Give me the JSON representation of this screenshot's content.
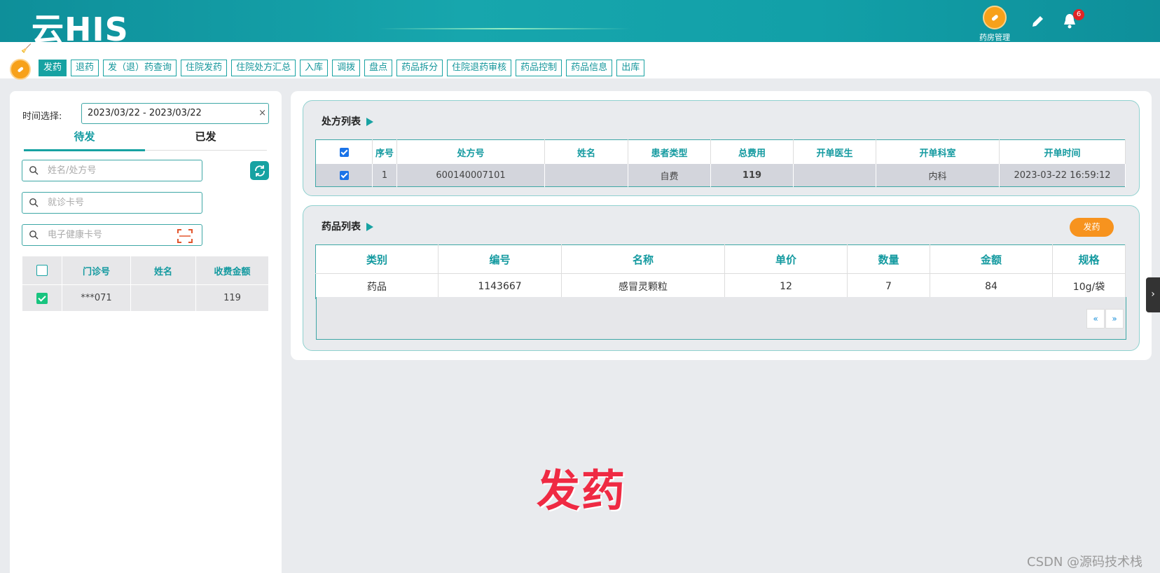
{
  "app": {
    "logo": "云HIS",
    "module_label": "药房管理",
    "notification_count": "6"
  },
  "tabs": [
    {
      "label": "发药",
      "active": true
    },
    {
      "label": "退药",
      "active": false
    },
    {
      "label": "发（退）药查询",
      "active": false
    },
    {
      "label": "住院发药",
      "active": false
    },
    {
      "label": "住院处方汇总",
      "active": false
    },
    {
      "label": "入库",
      "active": false
    },
    {
      "label": "调拨",
      "active": false
    },
    {
      "label": "盘点",
      "active": false
    },
    {
      "label": "药品拆分",
      "active": false
    },
    {
      "label": "住院退药审核",
      "active": false
    },
    {
      "label": "药品控制",
      "active": false
    },
    {
      "label": "药品信息",
      "active": false
    },
    {
      "label": "出库",
      "active": false
    }
  ],
  "left": {
    "time_label": "时间选择:",
    "date_range": "2023/03/22 - 2023/03/22",
    "clear_symbol": "×",
    "status_tabs": {
      "pending": "待发",
      "done": "已发"
    },
    "search_name_placeholder": "姓名/处方号",
    "search_card_placeholder": "就诊卡号",
    "search_health_placeholder": "电子健康卡号",
    "patient_table": {
      "headers": [
        "门诊号",
        "姓名",
        "收费金额"
      ],
      "rows": [
        {
          "checked": true,
          "clinic_no": "***071",
          "name": "",
          "amount": "119"
        }
      ]
    }
  },
  "prescriptions": {
    "title": "处方列表",
    "headers": [
      "序号",
      "处方号",
      "姓名",
      "患者类型",
      "总费用",
      "开单医生",
      "开单科室",
      "开单时间"
    ],
    "rows": [
      {
        "checked": true,
        "seq": "1",
        "rx_no": "600140007101",
        "name": "",
        "patient_type": "自费",
        "total": "119",
        "doctor": "",
        "dept": "内科",
        "time": "2023-03-22 16:59:12"
      }
    ]
  },
  "drugs": {
    "title": "药品列表",
    "dispense_button": "发药",
    "headers": [
      "类别",
      "编号",
      "名称",
      "单价",
      "数量",
      "金额",
      "规格"
    ],
    "rows": [
      {
        "category": "药品",
        "code": "1143667",
        "name": "感冒灵颗粒",
        "price": "12",
        "qty": "7",
        "amount": "84",
        "spec": "10g/袋"
      }
    ],
    "pager": {
      "prev": "«",
      "next": "»"
    }
  },
  "side_handle": "›",
  "overlay_caption": "发药",
  "watermark": "CSDN @源码技术栈",
  "colors": {
    "teal": "#17a2a2",
    "orange": "#f7931e",
    "overlay_red": "#ef2a43"
  }
}
